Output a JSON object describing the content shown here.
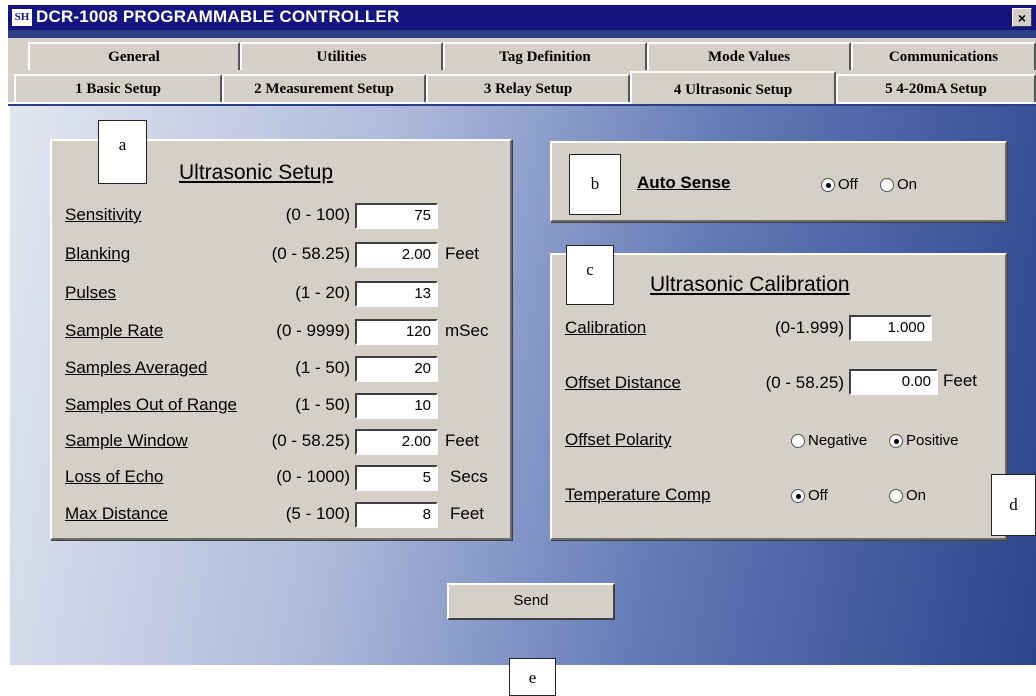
{
  "window": {
    "icon_text": "SH",
    "title": "DCR-1008 PROGRAMMABLE CONTROLLER",
    "close_label": "×"
  },
  "tabs_row1": [
    "General",
    "Utilities",
    "Tag Definition",
    "Mode Values",
    "Communications"
  ],
  "tabs_row2": [
    "1 Basic Setup",
    "2 Measurement Setup",
    "3 Relay Setup",
    "4 Ultrasonic Setup",
    "5 4-20mA Setup"
  ],
  "active_tab": "4 Ultrasonic Setup",
  "ultrasonic_setup": {
    "title": "Ultrasonic Setup",
    "fields": [
      {
        "label": "Sensitivity",
        "range": "(0 - 100)",
        "value": "75",
        "unit": ""
      },
      {
        "label": "Blanking",
        "range": "(0 - 58.25)",
        "value": "2.00",
        "unit": "Feet"
      },
      {
        "label": "Pulses",
        "range": "(1 - 20)",
        "value": "13",
        "unit": ""
      },
      {
        "label": "Sample Rate",
        "range": "(0 - 9999)",
        "value": "120",
        "unit": "mSec"
      },
      {
        "label": "Samples Averaged",
        "range": "(1 - 50)",
        "value": "20",
        "unit": ""
      },
      {
        "label": "Samples Out of Range",
        "range": "(1 - 50)",
        "value": "10",
        "unit": ""
      },
      {
        "label": "Sample Window",
        "range": "(0 - 58.25)",
        "value": "2.00",
        "unit": "Feet"
      },
      {
        "label": "Loss of Echo",
        "range": "(0 - 1000)",
        "value": "5",
        "unit": "Secs"
      },
      {
        "label": "Max Distance",
        "range": "(5 - 100)",
        "value": "8",
        "unit": "Feet"
      }
    ]
  },
  "auto_sense": {
    "label": "Auto Sense",
    "options": [
      "Off",
      "On"
    ],
    "selected": "Off"
  },
  "ultrasonic_calibration": {
    "title": "Ultrasonic Calibration",
    "calibration": {
      "label": "Calibration",
      "range": "(0-1.999)",
      "value": "1.000"
    },
    "offset_distance": {
      "label": "Offset Distance",
      "range": "(0 - 58.25)",
      "value": "0.00",
      "unit": "Feet"
    },
    "offset_polarity": {
      "label": "Offset Polarity",
      "options": [
        "Negative",
        "Positive"
      ],
      "selected": "Positive"
    },
    "temperature_comp": {
      "label": "Temperature Comp",
      "options": [
        "Off",
        "On"
      ],
      "selected": "Off"
    }
  },
  "send_label": "Send",
  "callouts": {
    "a": "a",
    "b": "b",
    "c": "c",
    "d": "d",
    "e": "e"
  }
}
